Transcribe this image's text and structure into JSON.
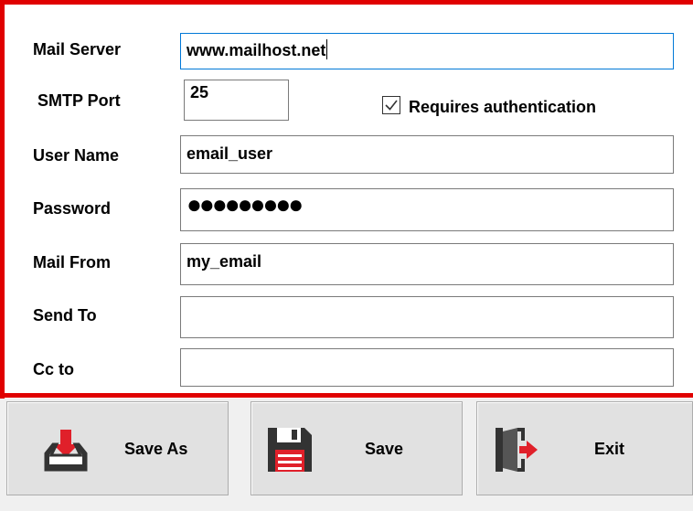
{
  "form": {
    "mail_server": {
      "label": "Mail Server",
      "value": "www.mailhost.net"
    },
    "smtp_port": {
      "label": "SMTP Port",
      "value": "25"
    },
    "requires_auth": {
      "label": "Requires authentication",
      "checked": true
    },
    "user_name": {
      "label": "User Name",
      "value": "email_user"
    },
    "password": {
      "label": "Password",
      "masked": "●●●●●●●●●"
    },
    "mail_from": {
      "label": "Mail From",
      "value": "my_email"
    },
    "send_to": {
      "label": "Send To",
      "value": ""
    },
    "cc_to": {
      "label": "Cc to",
      "value": ""
    }
  },
  "buttons": {
    "save_as": {
      "label": "Save As",
      "icon": "download-tray-icon"
    },
    "save": {
      "label": "Save",
      "icon": "floppy-disk-icon"
    },
    "exit": {
      "label": "Exit",
      "icon": "exit-door-icon"
    }
  },
  "colors": {
    "frame": "#e00000",
    "focus": "#0078d7",
    "icon_red": "#e0202a",
    "icon_dark": "#333333"
  }
}
